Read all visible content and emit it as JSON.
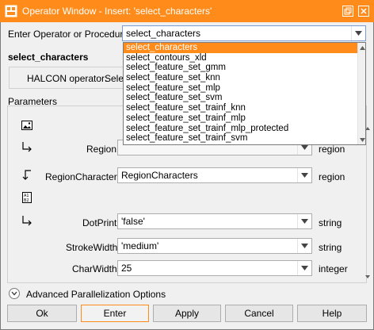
{
  "window": {
    "title": "Operator Window - Insert: 'select_characters'",
    "accent": "#ff8c1a"
  },
  "operator_row": {
    "label": "Enter Operator or Procedure",
    "value": "select_characters"
  },
  "dropdown": {
    "items": [
      "select_characters",
      "select_contours_xld",
      "select_feature_set_gmm",
      "select_feature_set_knn",
      "select_feature_set_mlp",
      "select_feature_set_svm",
      "select_feature_set_trainf_knn",
      "select_feature_set_trainf_mlp",
      "select_feature_set_trainf_mlp_protected",
      "select_feature_set_trainf_svm"
    ],
    "selected_index": 0
  },
  "header": {
    "operator_name": "select_characters",
    "info_label": "HALCON operator:",
    "info_value": "Selec"
  },
  "parameters": {
    "section_label": "Parameters",
    "rows": [
      {
        "label": "Region",
        "value": "",
        "type": "region"
      },
      {
        "label": "RegionCharacters",
        "value": "RegionCharacters",
        "type": "region"
      },
      {
        "label": "DotPrint",
        "value": "'false'",
        "type": "string"
      },
      {
        "label": "StrokeWidth",
        "value": "'medium'",
        "type": "string"
      },
      {
        "label": "CharWidth",
        "value": "25",
        "type": "integer"
      }
    ]
  },
  "advanced": {
    "label": "Advanced Parallelization Options"
  },
  "buttons": {
    "ok": "Ok",
    "enter": "Enter",
    "apply": "Apply",
    "cancel": "Cancel",
    "help": "Help"
  }
}
